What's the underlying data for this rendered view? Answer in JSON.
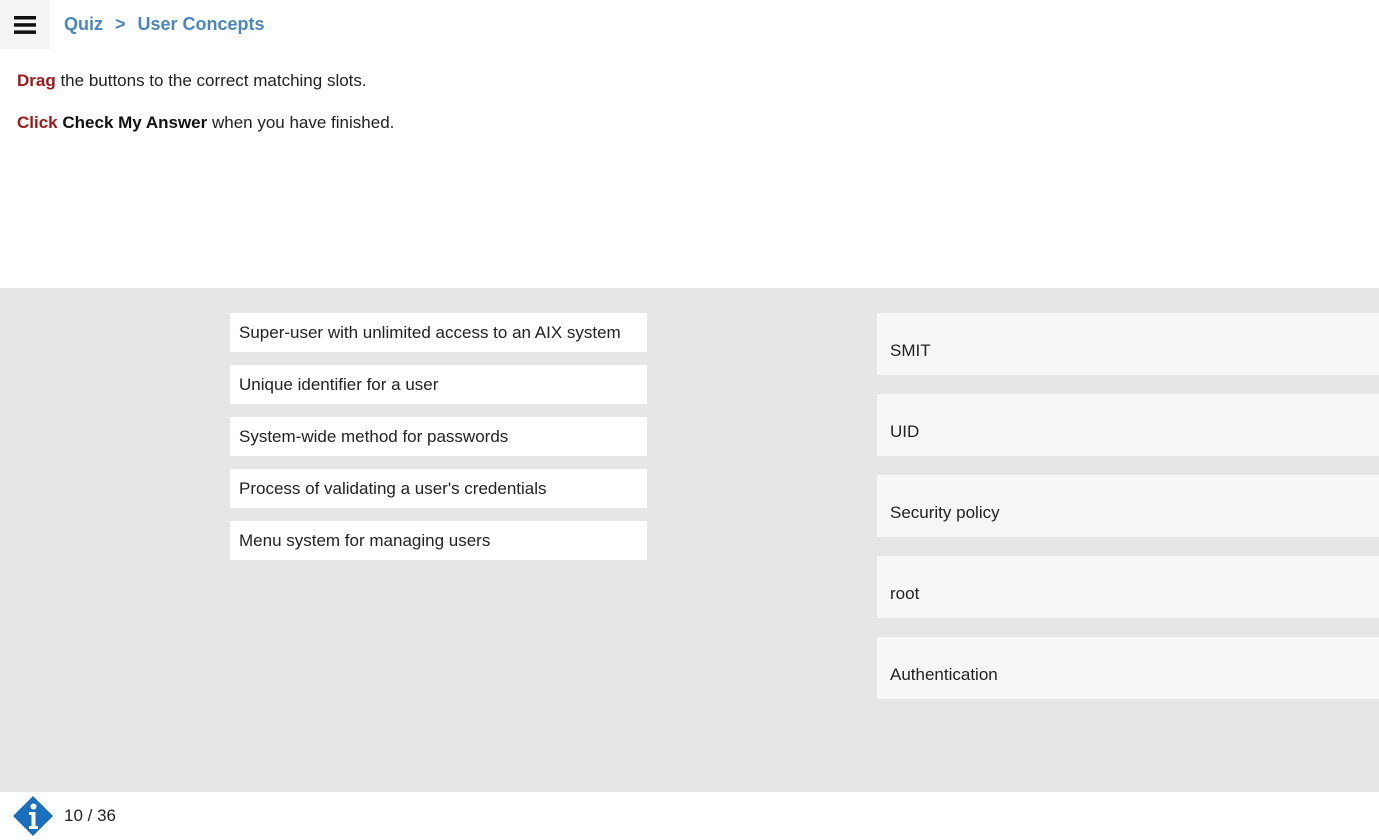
{
  "header": {
    "menu_icon": "hamburger-menu-icon",
    "breadcrumb": {
      "items": [
        "Quiz",
        "User Concepts"
      ],
      "separator": ">"
    }
  },
  "instructions": {
    "line1": {
      "action": "Drag",
      "rest": " the buttons to the correct matching slots."
    },
    "line2": {
      "action": "Click",
      "emphasis": "Check My Answer",
      "rest": " when you have finished."
    }
  },
  "colors": {
    "breadcrumb": "#4a86c0",
    "action_text": "#a01818",
    "match_area_bg": "#e6e6e6",
    "info_icon": "#1a6fbf"
  },
  "matching": {
    "draggables": [
      "Super-user with unlimited access to an AIX system",
      "Unique identifier for a user",
      "System-wide method for passwords",
      "Process of validating a user's credentials",
      "Menu system for managing users"
    ],
    "slots": [
      "SMIT",
      "UID",
      "Security policy",
      "root",
      "Authentication"
    ]
  },
  "footer": {
    "info_icon": "info-icon",
    "page_counter": "10 / 36"
  }
}
